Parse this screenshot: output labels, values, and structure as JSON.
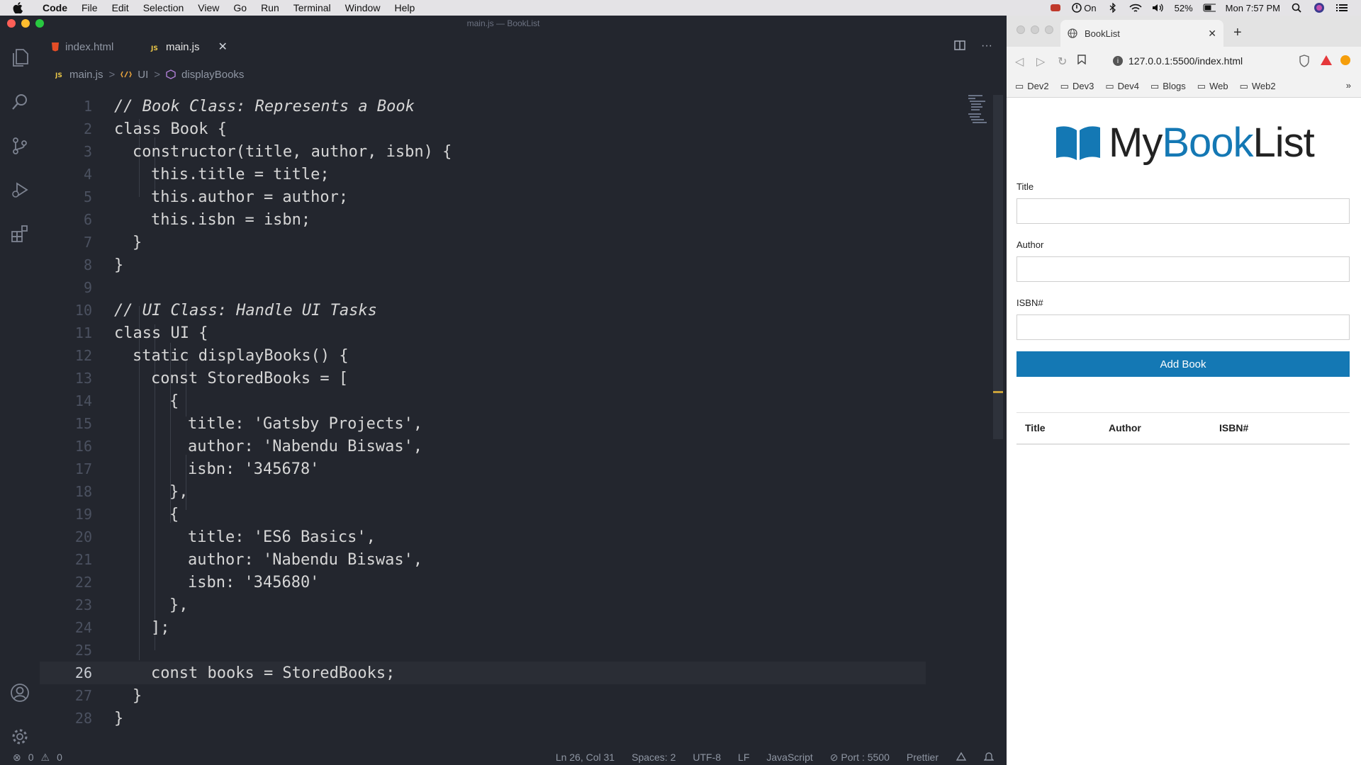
{
  "menubar": {
    "app": "Code",
    "items": [
      "File",
      "Edit",
      "Selection",
      "View",
      "Go",
      "Run",
      "Terminal",
      "Window",
      "Help"
    ],
    "status_on": "On",
    "battery": "52%",
    "clock": "Mon 7:57 PM"
  },
  "vscode": {
    "window_title": "main.js — BookList",
    "tabs": [
      {
        "label": "index.html",
        "icon": "html5-icon"
      },
      {
        "label": "main.js",
        "icon": "js-icon",
        "active": true
      }
    ],
    "breadcrumb": [
      "main.js",
      "UI",
      "displayBooks"
    ],
    "status": {
      "errors": "0",
      "warnings": "0",
      "position": "Ln 26, Col 31",
      "spaces": "Spaces: 2",
      "encoding": "UTF-8",
      "eol": "LF",
      "language": "JavaScript",
      "port": "Port : 5500",
      "formatter": "Prettier"
    }
  },
  "code_lines": [
    {
      "n": "1",
      "t": "// Book Class: Represents a Book"
    },
    {
      "n": "2",
      "t": "class Book {"
    },
    {
      "n": "3",
      "t": "constructor(title, author, isbn) {"
    },
    {
      "n": "4",
      "t": "this.title = title;"
    },
    {
      "n": "5",
      "t": "this.author = author;"
    },
    {
      "n": "6",
      "t": "this.isbn = isbn;"
    },
    {
      "n": "7",
      "t": "}"
    },
    {
      "n": "8",
      "t": "}"
    },
    {
      "n": "9",
      "t": ""
    },
    {
      "n": "10",
      "t": "// UI Class: Handle UI Tasks"
    },
    {
      "n": "11",
      "t": "class UI {"
    },
    {
      "n": "12",
      "t": "static displayBooks() {"
    },
    {
      "n": "13",
      "t": "const StoredBooks = ["
    },
    {
      "n": "14",
      "t": "{"
    },
    {
      "n": "15",
      "t": "title: 'Gatsby Projects',"
    },
    {
      "n": "16",
      "t": "author: 'Nabendu Biswas',"
    },
    {
      "n": "17",
      "t": "isbn: '345678'"
    },
    {
      "n": "18",
      "t": "},"
    },
    {
      "n": "19",
      "t": "{"
    },
    {
      "n": "20",
      "t": "title: 'ES6 Basics',"
    },
    {
      "n": "21",
      "t": "author: 'Nabendu Biswas',"
    },
    {
      "n": "22",
      "t": "isbn: '345680'"
    },
    {
      "n": "23",
      "t": "},"
    },
    {
      "n": "24",
      "t": "];"
    },
    {
      "n": "25",
      "t": ""
    },
    {
      "n": "26",
      "t": "const books = StoredBooks;"
    },
    {
      "n": "27",
      "t": "}"
    },
    {
      "n": "28",
      "t": "}"
    }
  ],
  "browser": {
    "tab_title": "BookList",
    "url": "127.0.0.1:5500/index.html",
    "bookmarks": [
      "Dev2",
      "Dev3",
      "Dev4",
      "Blogs",
      "Web",
      "Web2"
    ],
    "more": "»"
  },
  "app": {
    "logo_prefix": "My",
    "logo_brand": "Book",
    "logo_suffix": "List",
    "title_label": "Title",
    "author_label": "Author",
    "isbn_label": "ISBN#",
    "title_value": "",
    "author_value": "",
    "isbn_value": "",
    "submit_label": "Add Book",
    "columns": [
      "Title",
      "Author",
      "ISBN#"
    ]
  },
  "colors": {
    "accent": "#1478b4",
    "editor_bg": "#23262e"
  }
}
